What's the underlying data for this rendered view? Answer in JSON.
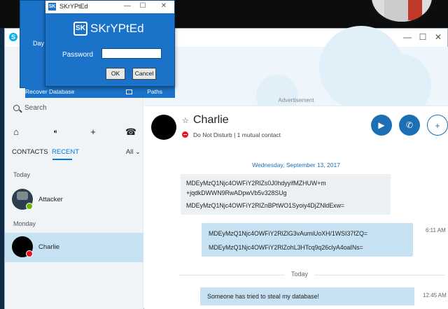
{
  "skype": {
    "window_title_initial": "S",
    "menu": "Skype",
    "search_placeholder": "Search",
    "tabs": {
      "contacts": "CONTACTS",
      "recent": "RECENT",
      "filter": "All"
    },
    "sections": {
      "today": "Today",
      "monday": "Monday"
    },
    "contacts": [
      {
        "name": "Attacker",
        "status_color": "#6bb700"
      },
      {
        "name": "Charlie",
        "status_color": "#e81123"
      }
    ],
    "ad_label": "Advertisement",
    "header": {
      "name": "Charlie",
      "status": "Do Not Disturb  |  1 mutual contact"
    },
    "chat": {
      "date": "Wednesday, September 13, 2017",
      "incoming": [
        "MDEyMzQ1Njc4OWFiY2RlZs0J0hdyyifMZHUW+m",
        "+jqdkDWWN9RwADpwVb5v328SUg",
        "MDEyMzQ1Njc4OWFiY2RlZnBPtWO1Syoiy4DjZNldExw="
      ],
      "outgoing": [
        "MDEyMzQ1Njc4OWFiY2RlZlG3vAumiUoXH/1WSI37fZQ=",
        "MDEyMzQ1Njc4OWFiY2RlZohL3HTcq9q26clyA4oaINs="
      ],
      "outgoing_time": "6:11 AM",
      "today": "Today",
      "last_message": "Someone has tried to steal my database!",
      "last_time": "12:45 AM"
    }
  },
  "dialog": {
    "title": "SKrYPtEd",
    "brand": "SKrYPtEd",
    "logo": "SK",
    "password_label": "Password",
    "password_value": "",
    "ok": "OK",
    "cancel": "Cancel",
    "back_label": "Day",
    "recover": "Recover Database",
    "paths": "Paths"
  },
  "colors": {
    "skype_blue": "#1c6fb3",
    "dialog_blue": "#1a73c9",
    "selected": "#c7e3f3"
  }
}
